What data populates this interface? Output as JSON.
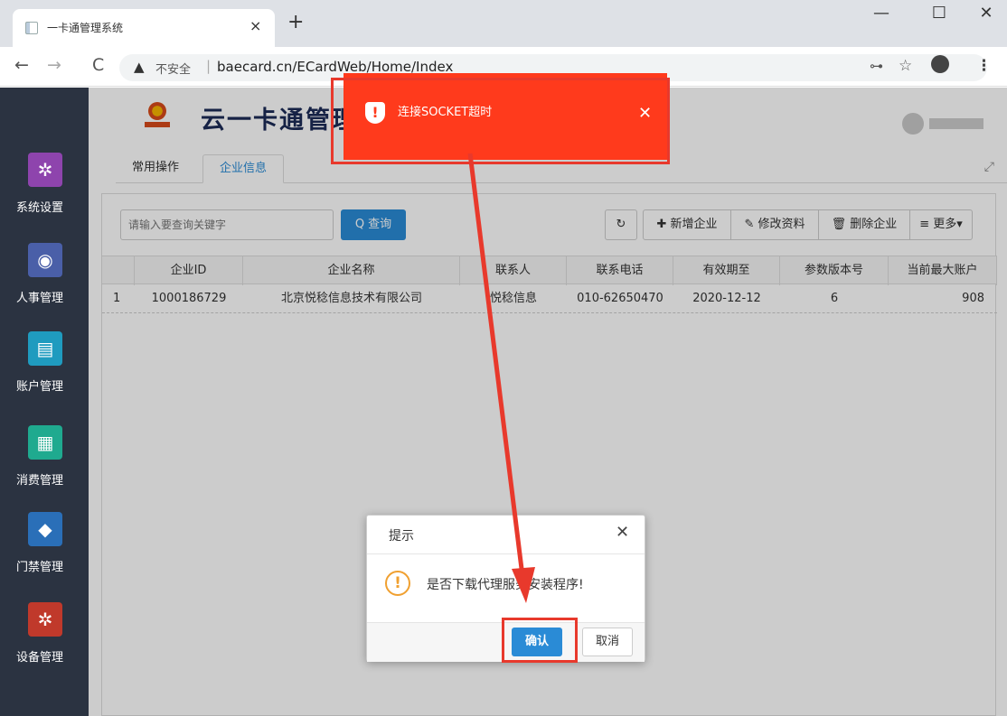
{
  "browser": {
    "tab_title": "一卡通管理系统",
    "tab_close": "×",
    "new_tab": "+",
    "win_min": "—",
    "win_max": "☐",
    "win_close": "✕",
    "back": "←",
    "forward": "→",
    "reload": "C",
    "warning_icon": "▲",
    "security_label": "不安全",
    "separator": "|",
    "url": "baecard.cn/ECardWeb/Home/Index",
    "key_icon": "⊶",
    "star_icon": "☆",
    "menu_icon": "⋮"
  },
  "app": {
    "title": "云一卡通管理",
    "tabs": [
      "常用操作",
      "企业信息"
    ],
    "expand_icon": "⤢"
  },
  "sidebar": {
    "items": [
      {
        "label": "系统设置",
        "icon": "gear-icon",
        "glyph": "✲",
        "color": "#8e44ad"
      },
      {
        "label": "人事管理",
        "icon": "user-icon",
        "glyph": "◉",
        "color": "#4a5fa8"
      },
      {
        "label": "账户管理",
        "icon": "id-card-icon",
        "glyph": "▤",
        "color": "#1f9bbf"
      },
      {
        "label": "消费管理",
        "icon": "calculator-icon",
        "glyph": "▦",
        "color": "#1faa8f"
      },
      {
        "label": "门禁管理",
        "icon": "lock-icon",
        "glyph": "◆",
        "color": "#2a6fb8"
      },
      {
        "label": "设备管理",
        "icon": "gears-icon",
        "glyph": "✲",
        "color": "#c0392b"
      }
    ]
  },
  "toolbar": {
    "search_placeholder": "请输入要查询关键字",
    "search_label": "Q 查询",
    "refresh_label": "↻",
    "add_label": "✚ 新增企业",
    "edit_label": "✎ 修改资料",
    "delete_label": "🗑 删除企业",
    "more_label": "≡ 更多▾"
  },
  "table": {
    "headers": [
      "企业ID",
      "企业名称",
      "联系人",
      "联系电话",
      "有效期至",
      "参数版本号",
      "当前最大账户"
    ],
    "rows": [
      [
        "1",
        "1000186729",
        "北京悦稔信息技术有限公司",
        "悦稔信息",
        "010-62650470",
        "2020-12-12",
        "6",
        "908"
      ]
    ]
  },
  "toast": {
    "message": "连接SOCKET超时",
    "close": "✕",
    "icon": "!"
  },
  "dialog": {
    "title": "提示",
    "close": "✕",
    "icon": "!",
    "message": "是否下载代理服务安装程序!",
    "ok_label": "确认",
    "cancel_label": "取消"
  },
  "colors": {
    "accent": "#2a8bd6",
    "toast": "#ff3a1c",
    "annotation": "#e8392c",
    "sidebar": "#2b3341"
  }
}
